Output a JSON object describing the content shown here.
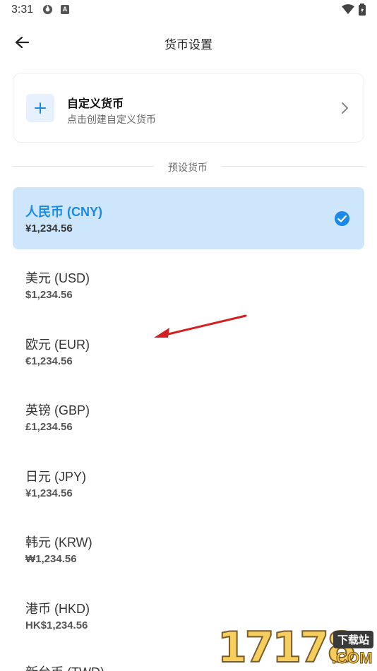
{
  "status_bar": {
    "time": "3:31",
    "icon_b": "A"
  },
  "header": {
    "title": "货币设置"
  },
  "custom_currency": {
    "title": "自定义货币",
    "subtitle": "点击创建自定义货币"
  },
  "preset_divider": {
    "label": "预设货币"
  },
  "currencies": [
    {
      "name": "人民币 (CNY)",
      "amount": "¥1,234.56",
      "selected": true
    },
    {
      "name": "美元 (USD)",
      "amount": "$1,234.56",
      "selected": false
    },
    {
      "name": "欧元 (EUR)",
      "amount": "€1,234.56",
      "selected": false
    },
    {
      "name": "英镑 (GBP)",
      "amount": "£1,234.56",
      "selected": false
    },
    {
      "name": "日元 (JPY)",
      "amount": "¥1,234.56",
      "selected": false
    },
    {
      "name": "韩元 (KRW)",
      "amount": "₩1,234.56",
      "selected": false
    },
    {
      "name": "港币 (HKD)",
      "amount": "HK$1,234.56",
      "selected": false
    },
    {
      "name": "新台币 (TWD)",
      "amount": "",
      "selected": false
    }
  ],
  "watermark": {
    "digits": "17178",
    "badge": "下载站",
    "suffix": ".COM"
  },
  "colors": {
    "accent": "#1a8ae6",
    "selected_bg": "#cde6fb",
    "annotation": "#d42020"
  },
  "icons": [
    "back-arrow-icon",
    "plus-icon",
    "chevron-right-icon",
    "check-circle-icon",
    "wifi-icon",
    "battery-icon"
  ]
}
